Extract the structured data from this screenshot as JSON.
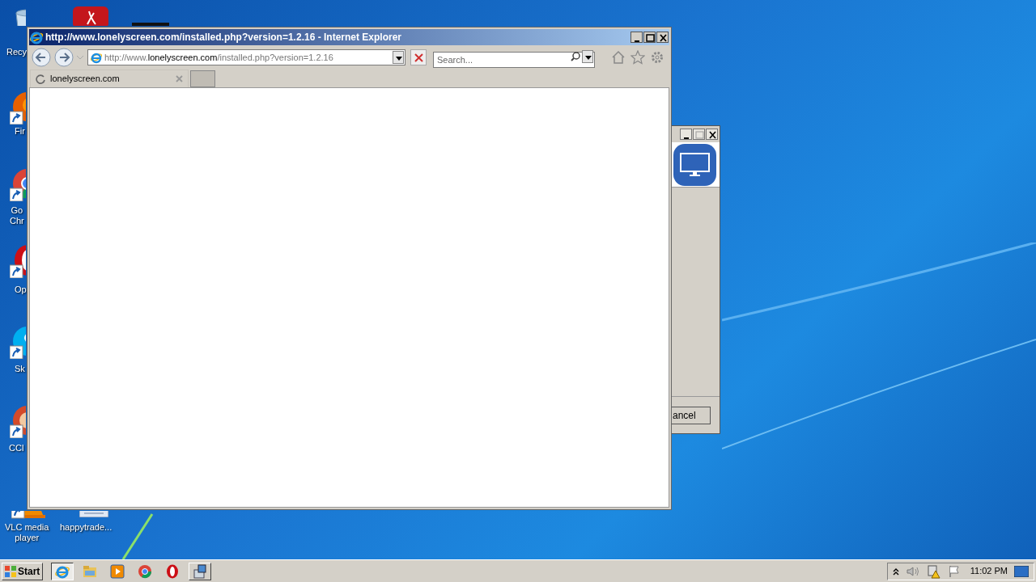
{
  "desktop": {
    "icons": [
      {
        "kind": "recycle-bin",
        "lines": [
          "Recy"
        ]
      },
      {
        "kind": "pdf"
      },
      {
        "kind": "dark-app"
      },
      {
        "kind": "firefox",
        "lines": [
          "Fir"
        ],
        "shortcut": true
      },
      {
        "kind": "chrome",
        "lines": [
          "Go",
          "Chr"
        ],
        "shortcut": true
      },
      {
        "kind": "opera",
        "lines": [
          "Op"
        ],
        "shortcut": true
      },
      {
        "kind": "skype",
        "lines": [
          "Sk"
        ],
        "shortcut": true
      },
      {
        "kind": "ccleaner",
        "lines": [
          "CCl"
        ],
        "shortcut": true
      },
      {
        "kind": "vlc",
        "lines": [
          "VLC media",
          "player"
        ],
        "shortcut": true
      },
      {
        "kind": "file",
        "lines": [
          "happytrade..."
        ]
      }
    ]
  },
  "browser": {
    "title": "http://www.lonelyscreen.com/installed.php?version=1.2.16 - Internet Explorer",
    "address": {
      "prefix": "http://www.",
      "domain": "lonelyscreen.com",
      "path": "/installed.php?version=1.2.16"
    },
    "search": {
      "placeholder": "Search..."
    },
    "tabs": [
      {
        "label": "lonelyscreen.com",
        "selected": true,
        "loading": true
      }
    ]
  },
  "background_window": {
    "button": "ancel"
  },
  "taskbar": {
    "start": "Start",
    "apps": [
      {
        "kind": "ie",
        "selected": true
      },
      {
        "kind": "folder",
        "selected": false
      },
      {
        "kind": "media",
        "selected": false
      },
      {
        "kind": "chrome",
        "selected": false
      },
      {
        "kind": "opera",
        "selected": false
      },
      {
        "kind": "installer",
        "selected": false
      }
    ],
    "clock": "11:02 PM"
  }
}
